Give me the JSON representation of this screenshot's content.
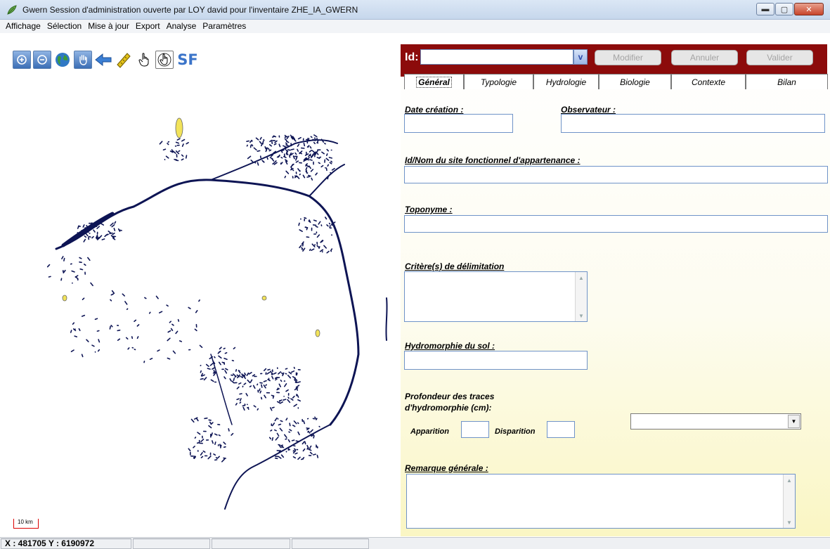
{
  "window": {
    "title": "Gwern  Session d'administration ouverte par LOY david pour l'inventaire ZHE_IA_GWERN",
    "buttons": {
      "minimize": "▬",
      "maximize": "▢",
      "close": "✕"
    }
  },
  "menu": [
    {
      "label": "Affichage"
    },
    {
      "label": "Sélection"
    },
    {
      "label": "Mise à jour"
    },
    {
      "label": "Export"
    },
    {
      "label": "Analyse"
    },
    {
      "label": "Paramètres"
    }
  ],
  "map_toolbar": {
    "tools": [
      "zoom-in-icon",
      "zoom-out-icon",
      "globe-icon",
      "pan-hand-icon",
      "back-arrow-icon",
      "measure-ruler-icon",
      "pointer-hand-icon",
      "select-hand-icon"
    ],
    "sf_label": "SF"
  },
  "map": {
    "scale_label": "10 km",
    "accent_color": "#0d1454",
    "highlight_color": "#f2e35a"
  },
  "status": {
    "coordinates": "X : 481705   Y : 6190972"
  },
  "idbar": {
    "label": "Id:",
    "value": "",
    "dropdown_label": "v",
    "modify": "Modifier",
    "cancel": "Annuler",
    "validate": "Valider",
    "color": "#8c0b0b"
  },
  "tabs": [
    {
      "label": "Général",
      "active": true
    },
    {
      "label": "Typologie"
    },
    {
      "label": "Hydrologie"
    },
    {
      "label": "Biologie"
    },
    {
      "label": "Contexte"
    },
    {
      "label": "Bilan"
    }
  ],
  "form": {
    "date_creation_label": "Date création :",
    "date_creation_value": "",
    "observateur_label": "Observateur :",
    "observateur_value": "",
    "site_fonctionnel_label": "Id/Nom du site fonctionnel d'appartenance :",
    "site_fonctionnel_value": "",
    "toponyme_label": "Toponyme :",
    "toponyme_value": "",
    "criteres_label": "Critère(s) de délimitation",
    "criteres_value": "",
    "hydromorphie_label": "Hydromorphie du sol :",
    "hydromorphie_value": "",
    "profondeur_label_1": "Profondeur des traces",
    "profondeur_label_2": "d'hydromorphie (cm):",
    "apparition_label": "Apparition",
    "apparition_value": "",
    "disparition_label": "Disparition",
    "disparition_value": "",
    "profondeur_select_value": "",
    "remarque_label": "Remarque générale :",
    "remarque_value": ""
  }
}
